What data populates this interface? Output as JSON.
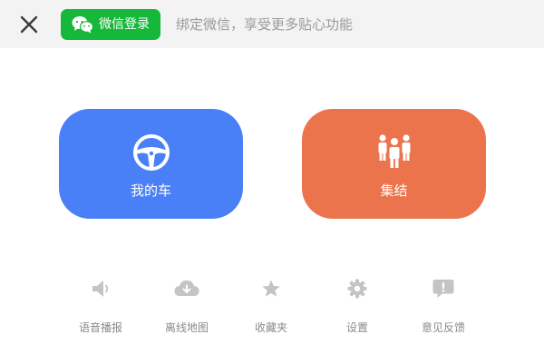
{
  "header": {
    "close_icon": "close-icon",
    "wechat_login": {
      "label": "微信登录",
      "icon": "wechat-icon",
      "color": "#15b83a"
    },
    "bind_hint": "绑定微信，享受更多贴心功能"
  },
  "tiles": [
    {
      "label": "我的车",
      "icon": "steering-wheel-icon",
      "color": "#4a80f7"
    },
    {
      "label": "集结",
      "icon": "group-people-icon",
      "color": "#eb744c"
    }
  ],
  "tools": [
    {
      "label": "语音播报",
      "icon": "speaker-icon"
    },
    {
      "label": "离线地图",
      "icon": "cloud-download-icon"
    },
    {
      "label": "收藏夹",
      "icon": "star-icon"
    },
    {
      "label": "设置",
      "icon": "gear-icon"
    },
    {
      "label": "意见反馈",
      "icon": "feedback-icon"
    }
  ]
}
